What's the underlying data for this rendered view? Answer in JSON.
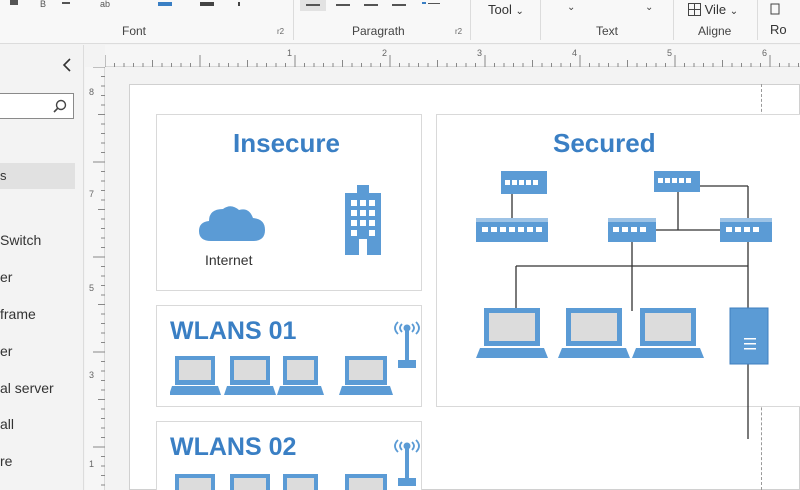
{
  "ribbon": {
    "groups": {
      "font": "Font",
      "paragraph": "Paragrath",
      "text": "Text",
      "align": "Aligne"
    },
    "launcher_glyph": "r2",
    "tool_label": "Tool",
    "view_label": "Vile",
    "cut_label": "Ro"
  },
  "left_panel": {
    "search_placeholder": "",
    "selected_item": "s",
    "stencils": [
      "Switch",
      "er",
      "frame",
      "er",
      "al server",
      "all",
      "re"
    ]
  },
  "rulers": {
    "horizontal": [
      "1",
      "2",
      "3",
      "4",
      "5",
      "6",
      "7"
    ],
    "vertical": [
      "8",
      "7",
      "5",
      "3",
      "1"
    ]
  },
  "diagram": {
    "insecure": {
      "title": "Insecure",
      "cloud_label": "Internet"
    },
    "secured": {
      "title": "Secured"
    },
    "wlan1": {
      "title": "WLANS 01"
    },
    "wlan2": {
      "title": "WLANS 02"
    }
  },
  "colors": {
    "accent": "#3a7fc4",
    "shape_fill": "#5b9bd5",
    "shape_light": "#9dc3e6",
    "screen_fill": "#dcdcdc"
  }
}
